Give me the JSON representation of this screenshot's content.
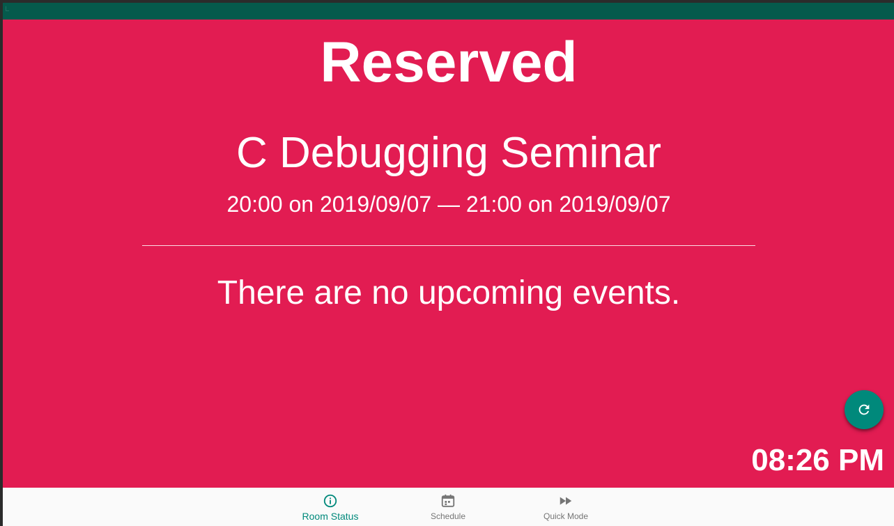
{
  "status": {
    "headline": "Reserved",
    "background_color": "#E21C52"
  },
  "current_event": {
    "title": "C Debugging Seminar",
    "time_range": "20:00 on 2019/09/07 — 21:00 on 2019/09/07"
  },
  "upcoming": {
    "message": "There are no upcoming events."
  },
  "refresh_button": {
    "icon": "refresh-icon",
    "color": "#00897B"
  },
  "clock": {
    "time": "08:26 PM"
  },
  "bottom_nav": {
    "items": [
      {
        "label": "Room Status",
        "icon": "info-icon",
        "active": true
      },
      {
        "label": "Schedule",
        "icon": "calendar-icon",
        "active": false
      },
      {
        "label": "Quick Mode",
        "icon": "fast-forward-icon",
        "active": false
      }
    ],
    "active_color": "#00897B",
    "inactive_color": "#757575"
  },
  "status_bar": {
    "color": "#055A4C"
  }
}
